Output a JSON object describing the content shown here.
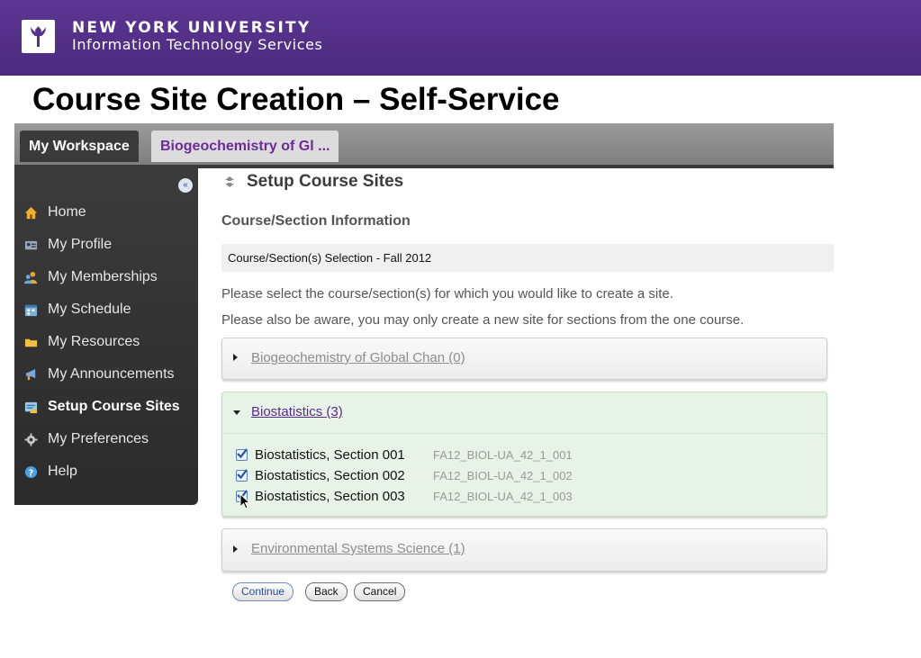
{
  "header": {
    "university": "NEW YORK UNIVERSITY",
    "department": "Information Technology Services",
    "logo_icon": "torch-icon"
  },
  "slide": {
    "title": "Course Site Creation – Self-Service"
  },
  "tabs": [
    {
      "label": "My Workspace",
      "active": true
    },
    {
      "label": "Biogeochemistry of Gl ...",
      "active": false
    }
  ],
  "sidebar": {
    "collapse_icon": "double-chevron-left-icon",
    "items": [
      {
        "label": "Home",
        "icon": "home-icon",
        "color": "#f0b030"
      },
      {
        "label": "My Profile",
        "icon": "profile-card-icon",
        "color": "#9aa6b8"
      },
      {
        "label": "My Memberships",
        "icon": "people-icon",
        "color": "#e8a63a"
      },
      {
        "label": "My Schedule",
        "icon": "calendar-icon",
        "color": "#7fb0d6"
      },
      {
        "label": "My Resources",
        "icon": "folder-icon",
        "color": "#f2c040"
      },
      {
        "label": "My Announcements",
        "icon": "megaphone-icon",
        "color": "#7aa8de"
      },
      {
        "label": "Setup Course Sites",
        "icon": "site-setup-icon",
        "color": "#f3c040",
        "active": true
      },
      {
        "label": "My Preferences",
        "icon": "gear-icon",
        "color": "#c8c8c8"
      },
      {
        "label": "Help",
        "icon": "help-icon",
        "color": "#4aa0e0"
      }
    ]
  },
  "main": {
    "title": "Setup Course Sites",
    "title_icon": "refresh-arrows-icon",
    "section_heading": "Course/Section Information",
    "selection_label": "Course/Section(s) Selection - Fall 2012",
    "instruction_1": "Please select the course/section(s) for which you would like to create a site.",
    "instruction_2": "Please also be aware, you may only create a new site for sections from the one course.",
    "courses": [
      {
        "label": "Biogeochemistry of Global Chan (0)",
        "expanded": false
      },
      {
        "label": "Biostatistics (3)",
        "expanded": true,
        "sections": [
          {
            "name": "Biostatistics, Section 001",
            "code": "FA12_BIOL-UA_42_1_001",
            "checked": true
          },
          {
            "name": "Biostatistics, Section 002",
            "code": "FA12_BIOL-UA_42_1_002",
            "checked": true
          },
          {
            "name": "Biostatistics, Section 003",
            "code": "FA12_BIOL-UA_42_1_003",
            "checked": true
          }
        ]
      },
      {
        "label": "Environmental Systems Science (1)",
        "expanded": false
      }
    ],
    "buttons": {
      "continue": "Continue",
      "back": "Back",
      "cancel": "Cancel"
    }
  },
  "colors": {
    "nyu_purple": "#57318c",
    "link_purple": "#5a2a8e",
    "expanded_panel": "#e8f3e8"
  }
}
